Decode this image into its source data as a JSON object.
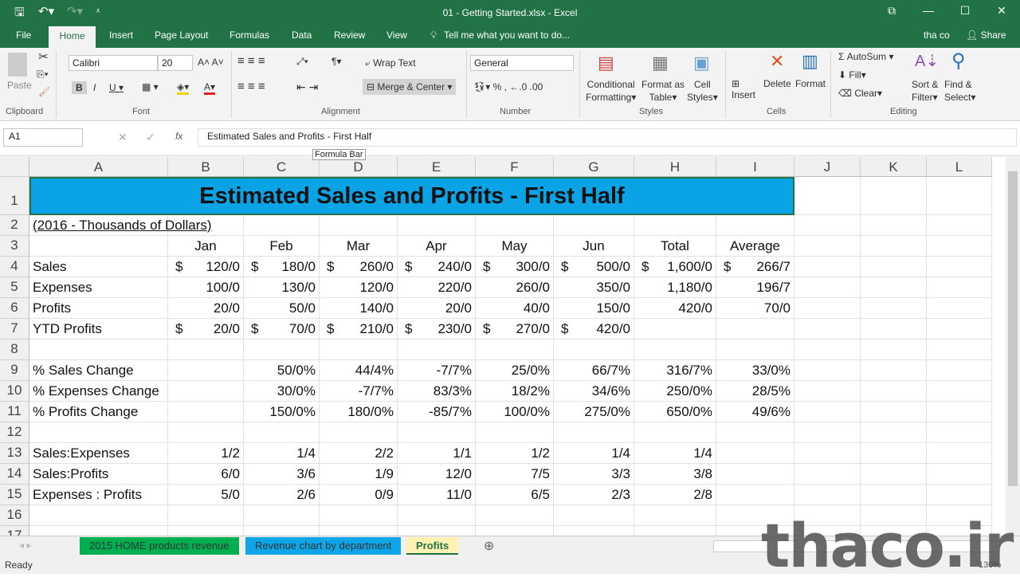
{
  "window": {
    "title": "01 - Getting Started.xlsx - Excel",
    "user": "tha co",
    "share": "Share"
  },
  "ribbon_tabs": [
    "File",
    "Home",
    "Insert",
    "Page Layout",
    "Formulas",
    "Data",
    "Review",
    "View"
  ],
  "tell_me": "Tell me what you want to do...",
  "ribbon": {
    "paste": "Paste",
    "font_name": "Calibri",
    "font_size": "20",
    "wrap_text": "Wrap Text",
    "merge_center": "Merge & Center",
    "number_format": "General",
    "cond_fmt_1": "Conditional",
    "cond_fmt_2": "Formatting",
    "fmt_table_1": "Format as",
    "fmt_table_2": "Table",
    "cell_styles_1": "Cell",
    "cell_styles_2": "Styles",
    "insert": "Insert",
    "delete": "Delete",
    "format": "Format",
    "autosum": "AutoSum",
    "fill": "Fill",
    "clear": "Clear",
    "sort_1": "Sort &",
    "sort_2": "Filter",
    "find_1": "Find &",
    "find_2": "Select",
    "groups": {
      "clipboard": "Clipboard",
      "font": "Font",
      "alignment": "Alignment",
      "number": "Number",
      "styles": "Styles",
      "cells": "Cells",
      "editing": "Editing"
    }
  },
  "formula_bar": {
    "name_box": "A1",
    "fx": "fx",
    "value": "Estimated Sales and Profits - First Half",
    "tooltip": "Formula Bar"
  },
  "columns": [
    "A",
    "B",
    "C",
    "D",
    "E",
    "F",
    "G",
    "H",
    "I",
    "J",
    "K",
    "L"
  ],
  "rows": [
    [
      "Estimated Sales and Profits - First Half"
    ],
    [
      "(2016 - Thousands of Dollars)"
    ],
    [
      "",
      "Jan",
      "Feb",
      "Mar",
      "Apr",
      "May",
      "Jun",
      "Total",
      "Average"
    ],
    [
      "Sales",
      "$ 120/0",
      "$ 180/0",
      "$ 260/0",
      "$ 240/0",
      "$ 300/0",
      "$ 500/0",
      "$ 1,600/0",
      "$ 266/7"
    ],
    [
      "Expenses",
      "100/0",
      "130/0",
      "120/0",
      "220/0",
      "260/0",
      "350/0",
      "1,180/0",
      "196/7"
    ],
    [
      "Profits",
      "20/0",
      "50/0",
      "140/0",
      "20/0",
      "40/0",
      "150/0",
      "420/0",
      "70/0"
    ],
    [
      "YTD Profits",
      "$ 20/0",
      "$ 70/0",
      "$ 210/0",
      "$ 230/0",
      "$ 270/0",
      "$ 420/0",
      "",
      ""
    ],
    [],
    [
      "% Sales Change",
      "",
      "50/0%",
      "44/4%",
      "-7/7%",
      "25/0%",
      "66/7%",
      "316/7%",
      "33/0%"
    ],
    [
      "% Expenses Change",
      "",
      "30/0%",
      "-7/7%",
      "83/3%",
      "18/2%",
      "34/6%",
      "250/0%",
      "28/5%"
    ],
    [
      "% Profits Change",
      "",
      "150/0%",
      "180/0%",
      "-85/7%",
      "100/0%",
      "275/0%",
      "650/0%",
      "49/6%"
    ],
    [],
    [
      "Sales:Expenses",
      "1/2",
      "1/4",
      "2/2",
      "1/1",
      "1/2",
      "1/4",
      "1/4"
    ],
    [
      "Sales:Profits",
      "6/0",
      "3/6",
      "1/9",
      "12/0",
      "7/5",
      "3/3",
      "3/8"
    ],
    [
      "Expenses :  Profits",
      "5/0",
      "2/6",
      "0/9",
      "11/0",
      "6/5",
      "2/3",
      "2/8"
    ],
    [],
    []
  ],
  "sheet_tabs": [
    {
      "label": "2015 HOME products revenue",
      "color": "#00b050"
    },
    {
      "label": "Revenue chart by department",
      "color": "#0ea5e9"
    },
    {
      "label": "Profits",
      "color": "#fff2b3",
      "active": true
    }
  ],
  "status": {
    "text": "Ready",
    "zoom": "130%"
  },
  "watermark": "thaco.ir",
  "colors": {
    "brand": "#217346",
    "title_fill": "#0aa3e6"
  }
}
